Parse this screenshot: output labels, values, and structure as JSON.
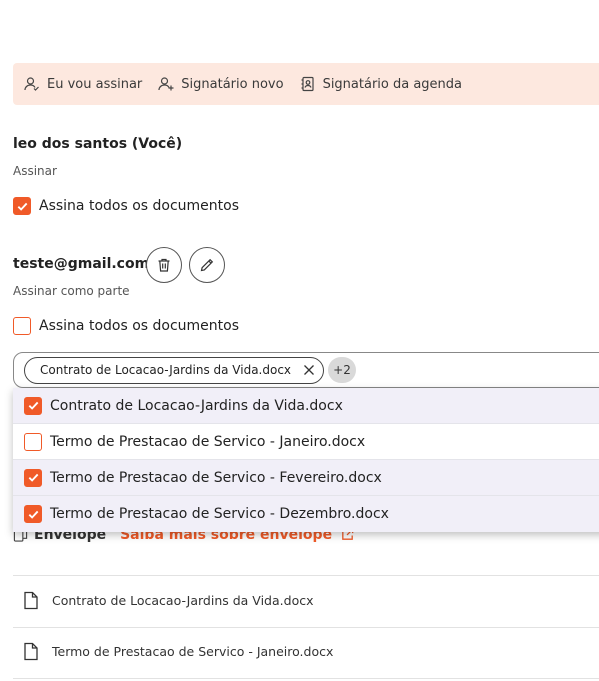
{
  "toolbar": {
    "i_will_sign": "Eu vou assinar",
    "new_signer": "Signatário novo",
    "agenda_signer": "Signatário da agenda"
  },
  "signers": [
    {
      "name": "leo dos santos (Você)",
      "role": "Assinar",
      "sign_all_label": "Assina todos os documentos",
      "sign_all_checked": true
    },
    {
      "name": "teste@gmail.com",
      "role": "Assinar como parte",
      "sign_all_label": "Assina todos os documentos",
      "sign_all_checked": false
    }
  ],
  "document_select": {
    "chip_label": "Contrato de Locacao-Jardins da Vida.docx",
    "more_count": "+2",
    "options": [
      {
        "label": "Contrato de Locacao-Jardins da Vida.docx",
        "checked": true
      },
      {
        "label": "Termo de Prestacao de Servico - Janeiro.docx",
        "checked": false
      },
      {
        "label": "Termo de Prestacao de Servico - Fevereiro.docx",
        "checked": true
      },
      {
        "label": "Termo de Prestacao de Servico - Dezembro.docx",
        "checked": true
      }
    ]
  },
  "envelope": {
    "title": "Envelope",
    "learn_more": "Saiba mais sobre envelope"
  },
  "files": [
    {
      "name": "Contrato de Locacao-Jardins da Vida.docx"
    },
    {
      "name": "Termo de Prestacao de Servico - Janeiro.docx"
    }
  ],
  "colors": {
    "accent": "#f05a28",
    "toolbar_bg": "#fde8df",
    "selected_row_bg": "#f1eff8"
  }
}
